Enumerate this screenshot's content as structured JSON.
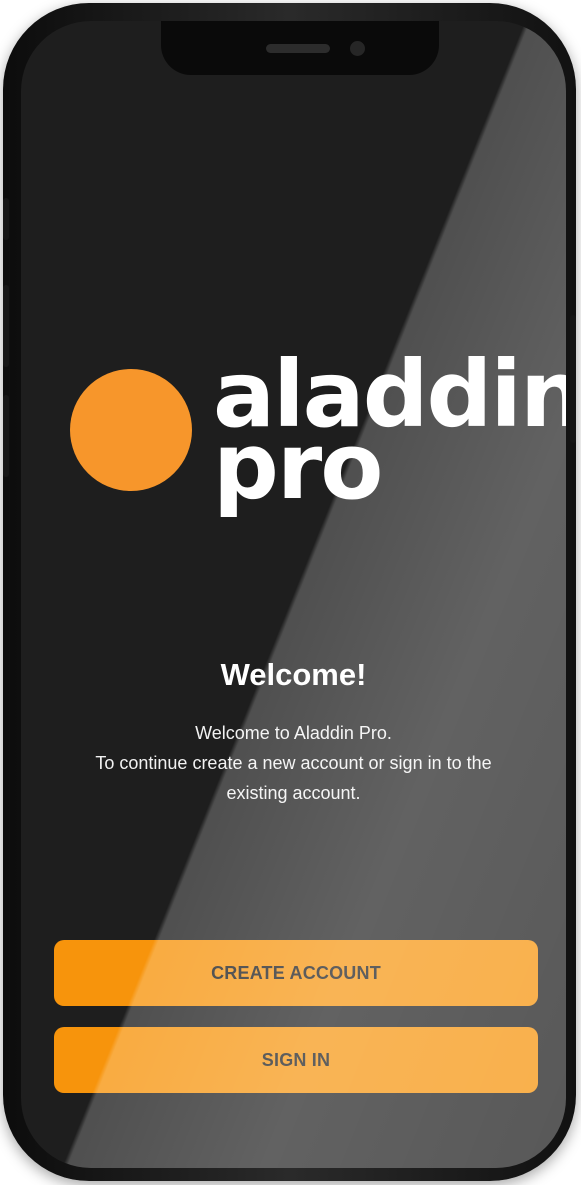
{
  "brand": {
    "word1": "aladdin",
    "word2": "pro",
    "accent_color": "#f7962b"
  },
  "welcome": {
    "title": "Welcome!",
    "line1": "Welcome to Aladdin Pro.",
    "line2": "To continue create a new account or sign in to the",
    "line3": "existing account."
  },
  "actions": {
    "create_account_label": "CREATE ACCOUNT",
    "sign_in_label": "SIGN IN",
    "button_color": "#f7940c"
  },
  "device": {
    "notch_icons": [
      "speaker-icon",
      "camera-icon"
    ]
  }
}
